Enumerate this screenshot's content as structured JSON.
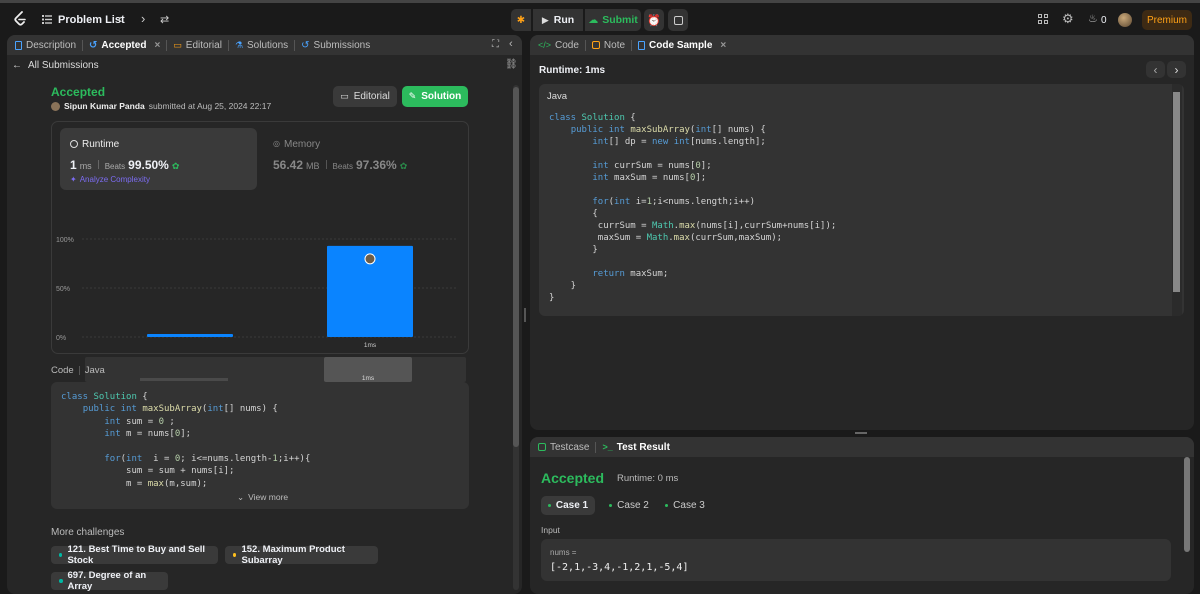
{
  "topbar": {
    "problem_list": "Problem List",
    "run": "Run",
    "submit": "Submit",
    "streak": "0",
    "premium": "Premium"
  },
  "left_tabs": {
    "description": "Description",
    "accepted": "Accepted",
    "editorial": "Editorial",
    "solutions": "Solutions",
    "submissions": "Submissions"
  },
  "left": {
    "all_submissions": "All Submissions",
    "status": "Accepted",
    "user": "Sipun Kumar Panda",
    "submitted_text": "submitted at Aug 25, 2024 22:17",
    "editorial_btn": "Editorial",
    "solution_btn": "Solution",
    "runtime": {
      "label": "Runtime",
      "value": "1",
      "unit": "ms",
      "beats_label": "Beats",
      "beats": "99.50%",
      "analyze": "Analyze Complexity"
    },
    "memory": {
      "label": "Memory",
      "value": "56.42",
      "unit": "MB",
      "beats_label": "Beats",
      "beats": "97.36%"
    },
    "code_label": "Code",
    "lang": "Java",
    "view_more": "View more",
    "more_challenges": "More challenges",
    "challenges": [
      "121. Best Time to Buy and Sell Stock",
      "152. Maximum Product Subarray",
      "697. Degree of an Array"
    ],
    "challenge_colors": [
      "#00b8a3",
      "#ffc01e",
      "#00b8a3"
    ]
  },
  "chart_data": {
    "type": "bar",
    "categories": [
      "",
      "1ms"
    ],
    "values": [
      3,
      93
    ],
    "yticks": [
      "100%",
      "50%",
      "0%"
    ],
    "ylim": [
      0,
      100
    ],
    "mini_label": "1ms"
  },
  "left_code": [
    "class Solution {",
    "    public int maxSubArray(int[] nums) {",
    "        int sum = 0 ;",
    "        int m = nums[0];",
    "",
    "        for(int  i = 0; i<=nums.length-1;i++){",
    "            sum = sum + nums[i];",
    "            m = max(m,sum);"
  ],
  "right_tabs": {
    "code": "Code",
    "note": "Note",
    "code_sample": "Code Sample"
  },
  "right": {
    "runtime_label": "Runtime: 1ms",
    "lang": "Java"
  },
  "right_code": [
    "class Solution {",
    "    public int maxSubArray(int[] nums) {",
    "        int[] dp = new int[nums.length];",
    "",
    "        int currSum = nums[0];",
    "        int maxSum = nums[0];",
    "",
    "        for(int i=1;i<nums.length;i++)",
    "        {",
    "         currSum = Math.max(nums[i],currSum+nums[i]);",
    "         maxSum = Math.max(currSum,maxSum);",
    "        }",
    "",
    "        return maxSum;",
    "    }",
    "}"
  ],
  "bottom_tabs": {
    "testcase": "Testcase",
    "result": "Test Result"
  },
  "result": {
    "status": "Accepted",
    "runtime": "Runtime: 0 ms",
    "cases": [
      "Case 1",
      "Case 2",
      "Case 3"
    ],
    "input_label": "Input",
    "var": "nums =",
    "value": "[-2,1,-3,4,-1,2,1,-5,4]"
  },
  "colors": {
    "accent": "#2cbb5d",
    "bar": "#0a84ff",
    "premium": "#ffa116"
  }
}
